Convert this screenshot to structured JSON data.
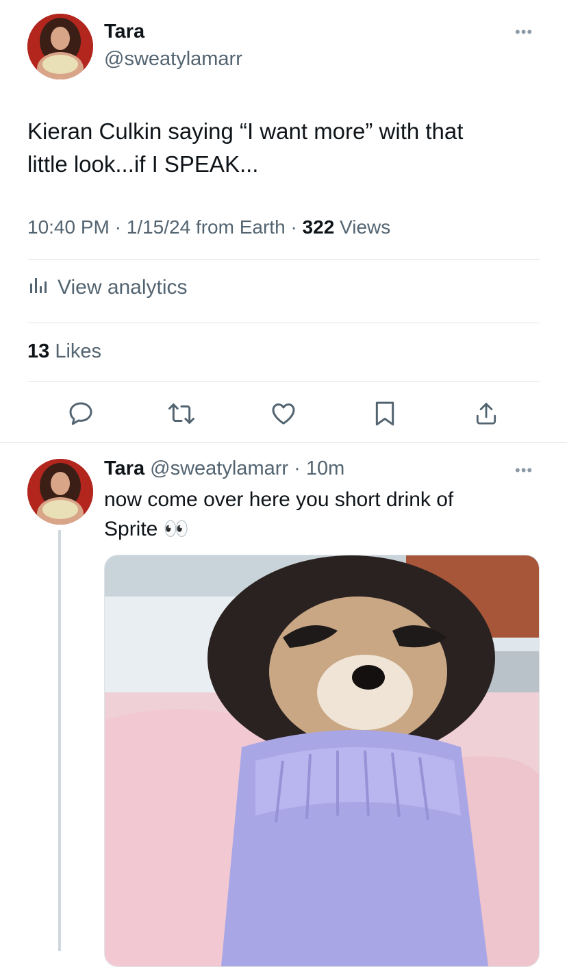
{
  "main_tweet": {
    "author_name": "Tara",
    "author_handle": "@sweatylamarr",
    "more_label": "•••",
    "text_line1": "Kieran Culkin saying “I want more” with that",
    "text_line2": "little look...if I SPEAK...",
    "time": "10:40 PM",
    "date": "1/15/24",
    "source": "from Earth",
    "views_count": "322",
    "views_label": "Views",
    "analytics_label": "View analytics",
    "likes_count": "13",
    "likes_label": "Likes"
  },
  "actions": [
    "reply-icon",
    "retweet-icon",
    "like-icon",
    "bookmark-icon",
    "share-icon"
  ],
  "reply_tweet": {
    "author_name": "Tara",
    "author_handle": "@sweatylamarr",
    "time_ago": "10m",
    "more_label": "•••",
    "text_line1": "now come over here you short drink of",
    "text_line2": "Sprite",
    "emoji": "👀"
  },
  "colors": {
    "text_primary": "#0f1419",
    "text_secondary": "#536471",
    "divider": "#dfe3e6",
    "thread_line": "#cfd9de"
  }
}
